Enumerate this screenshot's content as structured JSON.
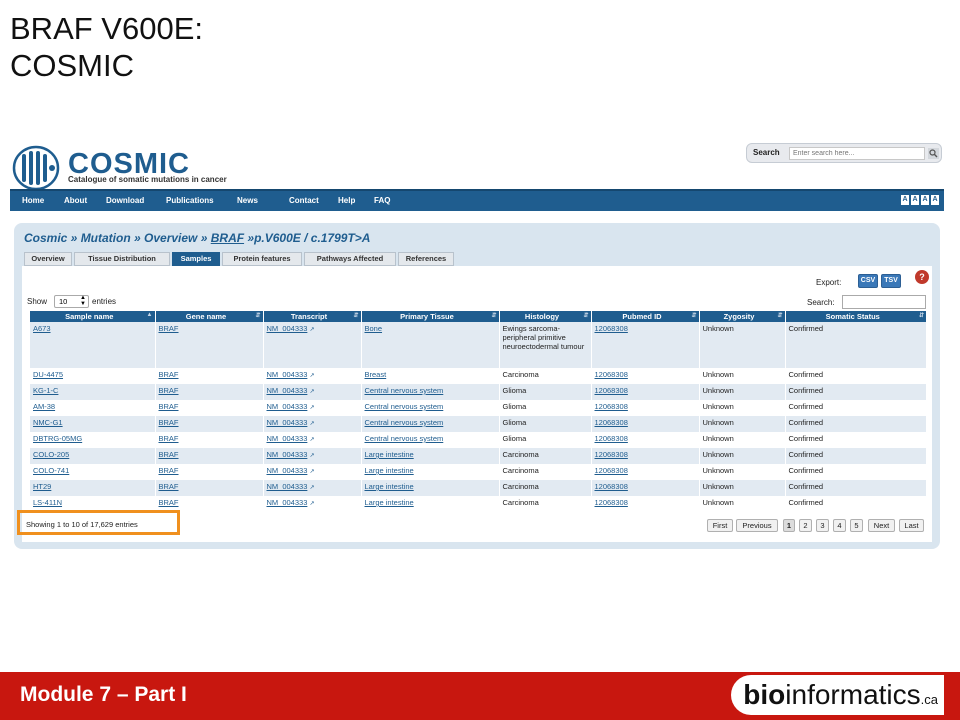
{
  "slide": {
    "title_line1": "BRAF V600E:",
    "title_line2": "COSMIC",
    "footer_left": "Module 7 – Part I",
    "footer_logo_bold": "bio",
    "footer_logo_rest": "informatics",
    "footer_logo_suffix": ".ca"
  },
  "header": {
    "brand": "COSMIC",
    "tagline": "Catalogue of somatic mutations in cancer",
    "search_label": "Search",
    "search_placeholder": "Enter search here..."
  },
  "nav": {
    "items": [
      "Home",
      "About",
      "Download",
      "Publications",
      "News",
      "Contact",
      "Help",
      "FAQ"
    ],
    "font_size_buttons": [
      "A",
      "A",
      "A",
      "A"
    ]
  },
  "breadcrumb": {
    "part1": "Cosmic » Mutation » Overview » ",
    "gene": "BRAF",
    "part2": " »p.V600E / c.1799T>A"
  },
  "tabs": [
    "Overview",
    "Tissue Distribution",
    "Samples",
    "Protein features",
    "Pathways Affected",
    "References"
  ],
  "export": {
    "label": "Export:",
    "csv": "CSV",
    "tsv": "TSV",
    "help": "?"
  },
  "controls": {
    "show_label": "Show",
    "page_size": "10",
    "entries_label": "entries",
    "search_label": "Search:"
  },
  "table": {
    "columns": [
      "Sample name",
      "Gene name",
      "Transcript",
      "Primary Tissue",
      "Histology",
      "Pubmed ID",
      "Zygosity",
      "Somatic Status"
    ],
    "rows": [
      [
        "A673",
        "BRAF",
        "NM_004333",
        "Bone",
        "Ewings sarcoma-peripheral primitive neuroectodermal tumour",
        "12068308",
        "Unknown",
        "Confirmed"
      ],
      [
        "DU-4475",
        "BRAF",
        "NM_004333",
        "Breast",
        "Carcinoma",
        "12068308",
        "Unknown",
        "Confirmed"
      ],
      [
        "KG-1-C",
        "BRAF",
        "NM_004333",
        "Central nervous system",
        "Glioma",
        "12068308",
        "Unknown",
        "Confirmed"
      ],
      [
        "AM-38",
        "BRAF",
        "NM_004333",
        "Central nervous system",
        "Glioma",
        "12068308",
        "Unknown",
        "Confirmed"
      ],
      [
        "NMC-G1",
        "BRAF",
        "NM_004333",
        "Central nervous system",
        "Glioma",
        "12068308",
        "Unknown",
        "Confirmed"
      ],
      [
        "DBTRG-05MG",
        "BRAF",
        "NM_004333",
        "Central nervous system",
        "Glioma",
        "12068308",
        "Unknown",
        "Confirmed"
      ],
      [
        "COLO-205",
        "BRAF",
        "NM_004333",
        "Large intestine",
        "Carcinoma",
        "12068308",
        "Unknown",
        "Confirmed"
      ],
      [
        "COLO-741",
        "BRAF",
        "NM_004333",
        "Large intestine",
        "Carcinoma",
        "12068308",
        "Unknown",
        "Confirmed"
      ],
      [
        "HT29",
        "BRAF",
        "NM_004333",
        "Large intestine",
        "Carcinoma",
        "12068308",
        "Unknown",
        "Confirmed"
      ],
      [
        "LS-411N",
        "BRAF",
        "NM_004333",
        "Large intestine",
        "Carcinoma",
        "12068308",
        "Unknown",
        "Confirmed"
      ]
    ]
  },
  "info": "Showing 1 to 10 of 17,629 entries",
  "pagination": [
    "First",
    "Previous",
    "1",
    "2",
    "3",
    "4",
    "5",
    "Next",
    "Last"
  ],
  "colors": {
    "accent": "#1f5d8f",
    "footer": "#c8170f",
    "highlight": "#f0901e"
  }
}
